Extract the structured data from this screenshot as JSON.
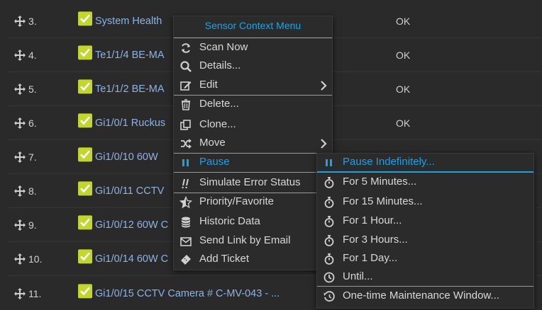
{
  "rows": [
    {
      "num": "3.",
      "name": "System Health",
      "status": "OK"
    },
    {
      "num": "4.",
      "name": "Te1/1/4 BE-MA",
      "status": "OK"
    },
    {
      "num": "5.",
      "name": "Te1/1/2 BE-MA",
      "status": "OK"
    },
    {
      "num": "6.",
      "name": "Gi1/0/1 Ruckus",
      "status": "OK"
    },
    {
      "num": "7.",
      "name": "Gi1/0/10 60W",
      "status": ""
    },
    {
      "num": "8.",
      "name": "Gi1/0/11 CCTV",
      "status": ""
    },
    {
      "num": "9.",
      "name": "Gi1/0/12 60W C",
      "status": ""
    },
    {
      "num": "10.",
      "name": "Gi1/0/14 60W C",
      "status": ""
    },
    {
      "num": "11.",
      "name": "Gi1/0/15 CCTV Camera # C-MV-043 - ...",
      "status": ""
    }
  ],
  "context_menu": {
    "title": "Sensor Context Menu",
    "items": [
      {
        "label": "Scan Now",
        "icon": "refresh-icon"
      },
      {
        "label": "Details...",
        "icon": "search-icon"
      },
      {
        "label": "Edit",
        "icon": "edit-icon",
        "submenu": true
      },
      {
        "label": "Delete...",
        "icon": "trash-icon"
      },
      {
        "label": "Clone...",
        "icon": "clone-icon"
      },
      {
        "label": "Move",
        "icon": "shuffle-icon",
        "submenu": true
      },
      {
        "label": "Pause",
        "icon": "pause-icon",
        "submenu": true,
        "active": true
      },
      {
        "label": "Simulate Error Status",
        "icon": "double-exclamation-icon"
      },
      {
        "label": "Priority/Favorite",
        "icon": "star-half-icon"
      },
      {
        "label": "Historic Data",
        "icon": "database-icon"
      },
      {
        "label": "Send Link by Email",
        "icon": "envelope-icon"
      },
      {
        "label": "Add Ticket",
        "icon": "ticket-icon"
      }
    ]
  },
  "pause_submenu": {
    "items": [
      {
        "label": "Pause Indefinitely...",
        "icon": "pause-icon",
        "active": true
      },
      {
        "label": "For 5 Minutes...",
        "icon": "stopwatch-icon"
      },
      {
        "label": "For 15 Minutes...",
        "icon": "stopwatch-icon"
      },
      {
        "label": "For 1 Hour...",
        "icon": "stopwatch-icon"
      },
      {
        "label": "For 3 Hours...",
        "icon": "stopwatch-icon"
      },
      {
        "label": "For 1 Day...",
        "icon": "stopwatch-icon"
      },
      {
        "label": "Until...",
        "icon": "clock-icon"
      },
      {
        "label": "One-time Maintenance Window...",
        "icon": "history-icon"
      }
    ]
  },
  "colors": {
    "accent": "#1ea0e6",
    "check": "#c3d62e",
    "link": "#8db3e6",
    "background": "#2a2a2a"
  }
}
